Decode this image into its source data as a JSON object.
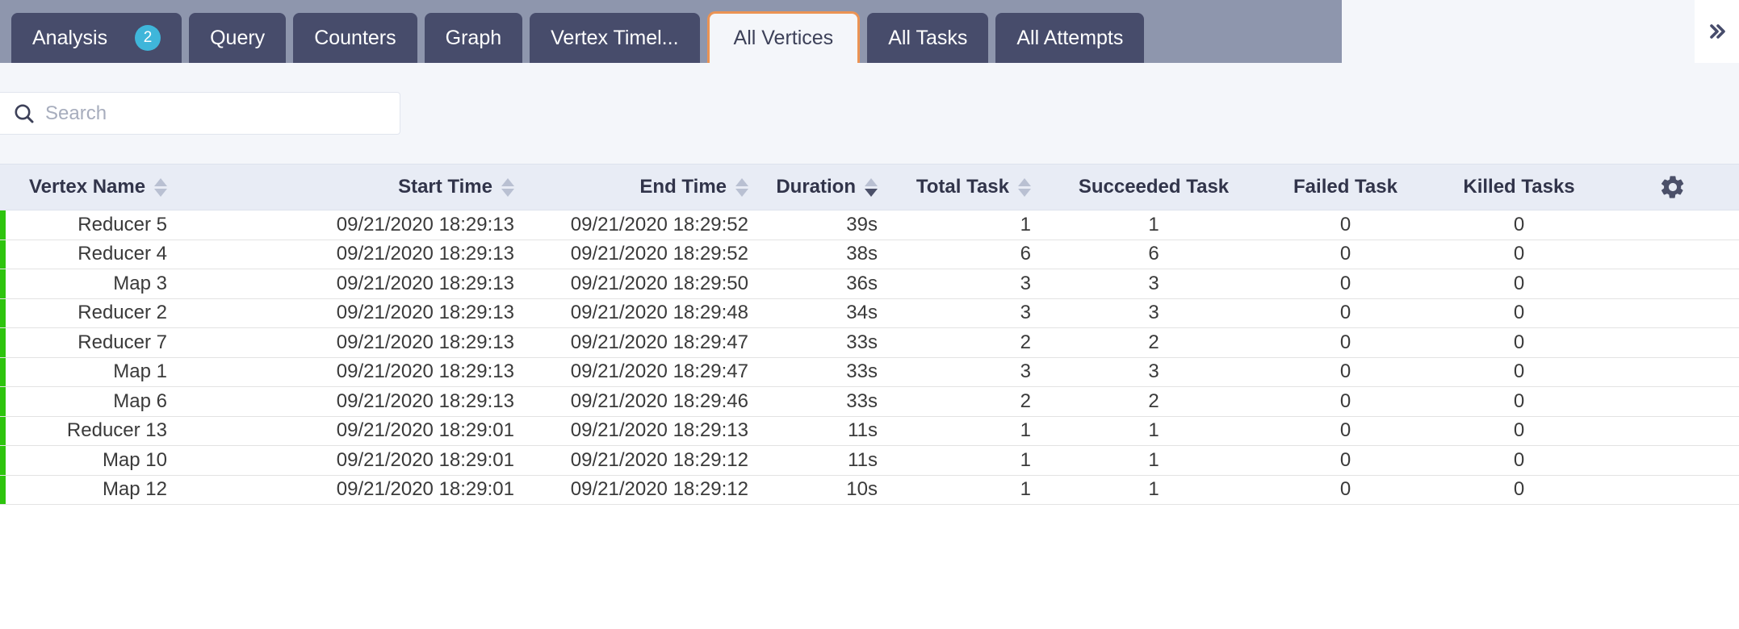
{
  "tabs": [
    {
      "label": "Analysis",
      "badge": "2",
      "active": false
    },
    {
      "label": "Query",
      "badge": null,
      "active": false
    },
    {
      "label": "Counters",
      "badge": null,
      "active": false
    },
    {
      "label": "Graph",
      "badge": null,
      "active": false
    },
    {
      "label": "Vertex Timel...",
      "badge": null,
      "active": false
    },
    {
      "label": "All Vertices",
      "badge": null,
      "active": true
    },
    {
      "label": "All Tasks",
      "badge": null,
      "active": false
    },
    {
      "label": "All Attempts",
      "badge": null,
      "active": false
    }
  ],
  "overflow_button": {
    "icon": "double-chevron-right-icon",
    "label": "»"
  },
  "search": {
    "placeholder": "Search",
    "value": "",
    "icon": "search-icon"
  },
  "table": {
    "settings_icon": "gear-icon",
    "columns": [
      {
        "key": "vertex_name",
        "label": "Vertex Name",
        "align": "left",
        "sortable": true,
        "sort": "none"
      },
      {
        "key": "start_time",
        "label": "Start Time",
        "align": "right",
        "sortable": true,
        "sort": "none"
      },
      {
        "key": "end_time",
        "label": "End Time",
        "align": "right",
        "sortable": true,
        "sort": "none"
      },
      {
        "key": "duration",
        "label": "Duration",
        "align": "right",
        "sortable": true,
        "sort": "desc"
      },
      {
        "key": "total_task",
        "label": "Total Task",
        "align": "right",
        "sortable": true,
        "sort": "none"
      },
      {
        "key": "succeeded_task",
        "label": "Succeeded Task",
        "align": "center",
        "sortable": false,
        "sort": "none"
      },
      {
        "key": "failed_task",
        "label": "Failed Task",
        "align": "center",
        "sortable": false,
        "sort": "none"
      },
      {
        "key": "killed_tasks",
        "label": "Killed Tasks",
        "align": "center",
        "sortable": false,
        "sort": "none"
      }
    ],
    "status_color": "#2ec40e",
    "rows": [
      {
        "vertex_name": "Reducer 5",
        "start_time": "09/21/2020 18:29:13",
        "end_time": "09/21/2020 18:29:52",
        "duration": "39s",
        "total_task": "1",
        "succeeded_task": "1",
        "failed_task": "0",
        "killed_tasks": "0"
      },
      {
        "vertex_name": "Reducer 4",
        "start_time": "09/21/2020 18:29:13",
        "end_time": "09/21/2020 18:29:52",
        "duration": "38s",
        "total_task": "6",
        "succeeded_task": "6",
        "failed_task": "0",
        "killed_tasks": "0"
      },
      {
        "vertex_name": "Map 3",
        "start_time": "09/21/2020 18:29:13",
        "end_time": "09/21/2020 18:29:50",
        "duration": "36s",
        "total_task": "3",
        "succeeded_task": "3",
        "failed_task": "0",
        "killed_tasks": "0"
      },
      {
        "vertex_name": "Reducer 2",
        "start_time": "09/21/2020 18:29:13",
        "end_time": "09/21/2020 18:29:48",
        "duration": "34s",
        "total_task": "3",
        "succeeded_task": "3",
        "failed_task": "0",
        "killed_tasks": "0"
      },
      {
        "vertex_name": "Reducer 7",
        "start_time": "09/21/2020 18:29:13",
        "end_time": "09/21/2020 18:29:47",
        "duration": "33s",
        "total_task": "2",
        "succeeded_task": "2",
        "failed_task": "0",
        "killed_tasks": "0"
      },
      {
        "vertex_name": "Map 1",
        "start_time": "09/21/2020 18:29:13",
        "end_time": "09/21/2020 18:29:47",
        "duration": "33s",
        "total_task": "3",
        "succeeded_task": "3",
        "failed_task": "0",
        "killed_tasks": "0"
      },
      {
        "vertex_name": "Map 6",
        "start_time": "09/21/2020 18:29:13",
        "end_time": "09/21/2020 18:29:46",
        "duration": "33s",
        "total_task": "2",
        "succeeded_task": "2",
        "failed_task": "0",
        "killed_tasks": "0"
      },
      {
        "vertex_name": "Reducer 13",
        "start_time": "09/21/2020 18:29:01",
        "end_time": "09/21/2020 18:29:13",
        "duration": "11s",
        "total_task": "1",
        "succeeded_task": "1",
        "failed_task": "0",
        "killed_tasks": "0"
      },
      {
        "vertex_name": "Map 10",
        "start_time": "09/21/2020 18:29:01",
        "end_time": "09/21/2020 18:29:12",
        "duration": "11s",
        "total_task": "1",
        "succeeded_task": "1",
        "failed_task": "0",
        "killed_tasks": "0"
      },
      {
        "vertex_name": "Map 12",
        "start_time": "09/21/2020 18:29:01",
        "end_time": "09/21/2020 18:29:12",
        "duration": "10s",
        "total_task": "1",
        "succeeded_task": "1",
        "failed_task": "0",
        "killed_tasks": "0"
      }
    ]
  },
  "colors": {
    "tabstrip_bg": "#8e96ad",
    "tab_bg": "#474c6b",
    "tab_active_border": "#eb9354",
    "badge_bg": "#3fb6da",
    "page_bg": "#f4f6fa",
    "header_bg": "#e8ecf5",
    "status_green": "#2ec40e"
  }
}
